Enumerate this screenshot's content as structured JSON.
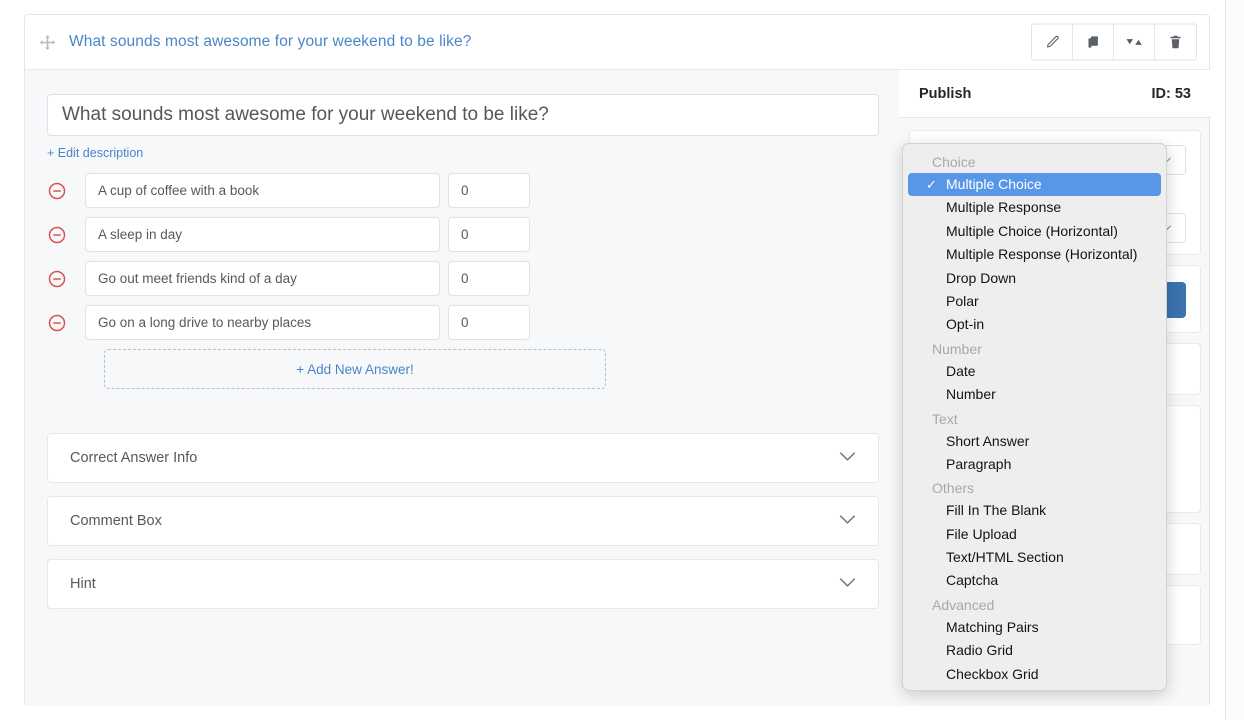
{
  "header": {
    "drag_icon": "move-arrows-icon",
    "title": "What sounds most awesome for your weekend to be like?",
    "tools": [
      {
        "name": "edit",
        "icon": "pencil-icon",
        "glyph": "✎"
      },
      {
        "name": "duplicate",
        "icon": "copy-icon",
        "glyph": "⧉"
      },
      {
        "name": "reorder",
        "icon": "sort-arrows-icon",
        "glyph": "▼▲"
      },
      {
        "name": "delete",
        "icon": "trash-icon",
        "glyph": "🗑"
      }
    ]
  },
  "editor": {
    "question_value": "What sounds most awesome for your weekend to be like?",
    "question_placeholder": "Question title",
    "edit_description_label": "+ Edit description",
    "answers": [
      {
        "text": "A cup of coffee with a book",
        "score": "0"
      },
      {
        "text": "A sleep in day",
        "score": "0"
      },
      {
        "text": "Go out meet friends kind of a day",
        "score": "0"
      },
      {
        "text": "Go on a long drive to nearby places",
        "score": "0"
      }
    ],
    "answer_placeholder": "Answer",
    "score_placeholder": "0",
    "add_answer_label": "+ Add New Answer!",
    "panels": [
      {
        "label": "Correct Answer Info",
        "chevron": "chevron-down-icon"
      },
      {
        "label": "Comment Box",
        "chevron": "chevron-down-icon"
      },
      {
        "label": "Hint",
        "chevron": "chevron-down-icon"
      }
    ]
  },
  "sidebar": {
    "publish_label": "Publish",
    "id_label": "ID: 53"
  },
  "dropdown": {
    "selected": "Multiple Choice",
    "check_glyph": "✓",
    "groups": [
      {
        "label": "Choice",
        "items": [
          "Multiple Choice",
          "Multiple Response",
          "Multiple Choice (Horizontal)",
          "Multiple Response (Horizontal)",
          "Drop Down",
          "Polar",
          "Opt-in"
        ]
      },
      {
        "label": "Number",
        "items": [
          "Date",
          "Number"
        ]
      },
      {
        "label": "Text",
        "items": [
          "Short Answer",
          "Paragraph"
        ]
      },
      {
        "label": "Others",
        "items": [
          "Fill In The Blank",
          "File Upload",
          "Text/HTML Section",
          "Captcha"
        ]
      },
      {
        "label": "Advanced",
        "items": [
          "Matching Pairs",
          "Radio Grid",
          "Checkbox Grid"
        ]
      }
    ]
  },
  "colors": {
    "accent_blue": "#4a86c8",
    "selection_blue": "#5896e8",
    "remove_red": "#d9534f",
    "body_bg": "#f7f8f9",
    "button_blue": "#3b72b0"
  }
}
